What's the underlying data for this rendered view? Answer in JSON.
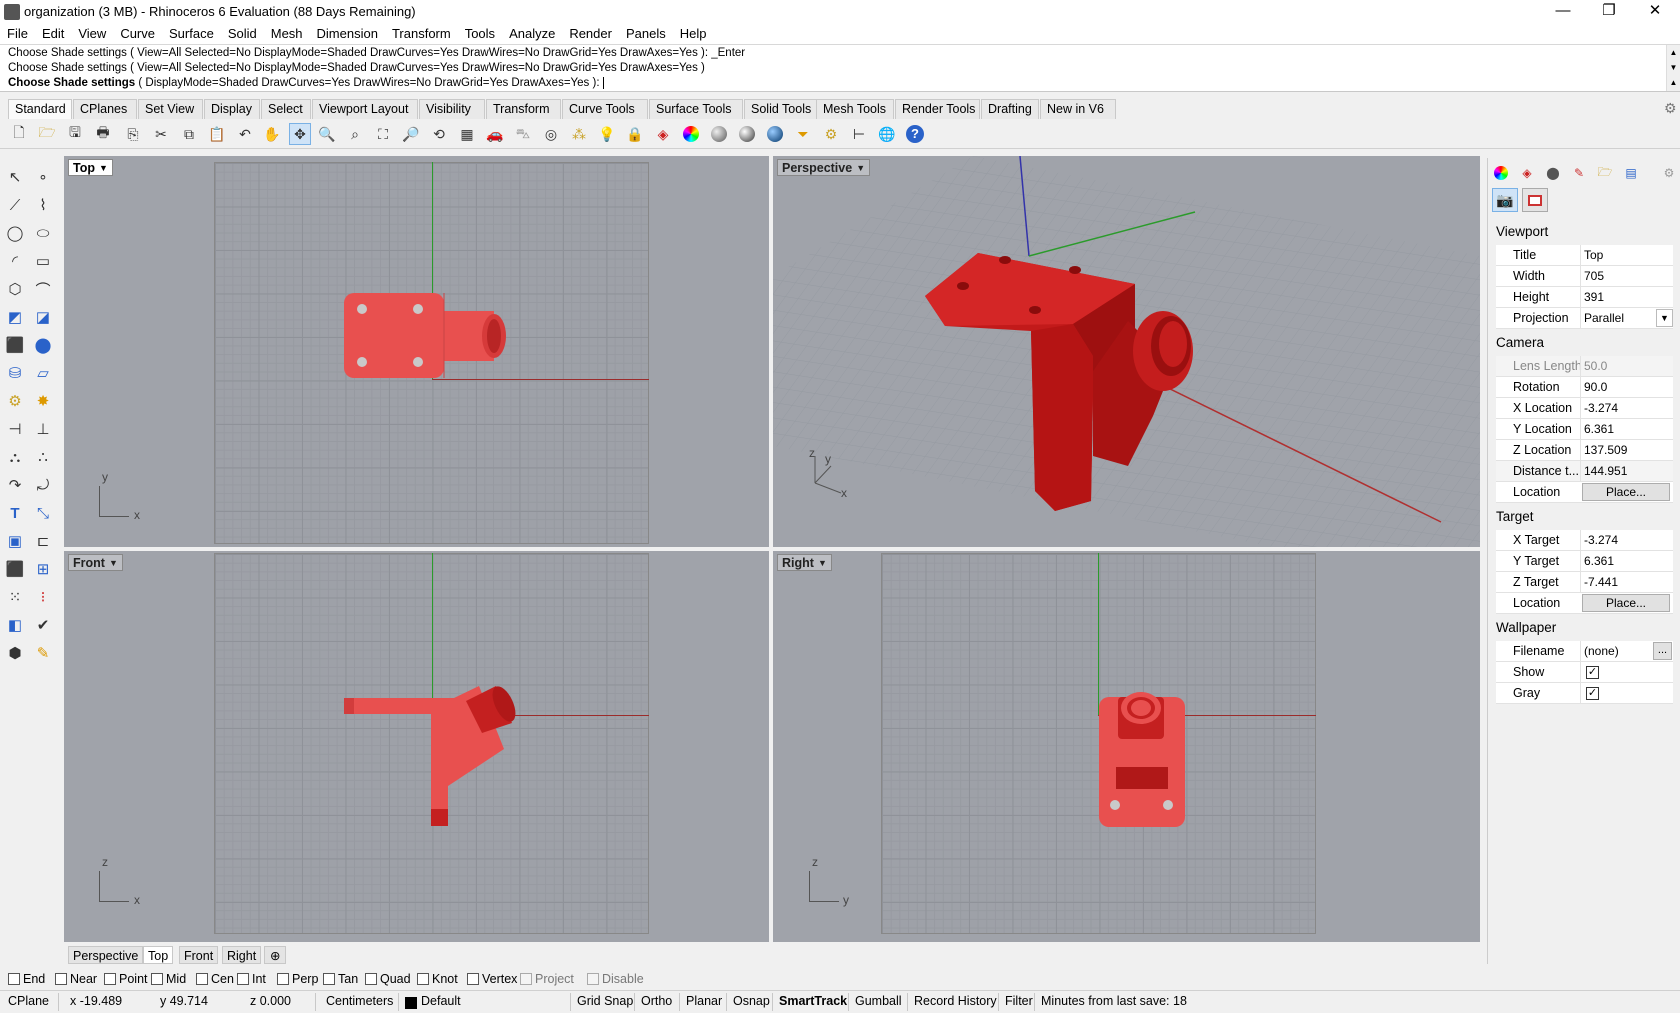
{
  "window": {
    "title": "organization (3 MB) - Rhinoceros 6 Evaluation (88 Days Remaining)",
    "minimize": "—",
    "maximize": "❐",
    "close": "✕"
  },
  "menu": [
    "File",
    "Edit",
    "View",
    "Curve",
    "Surface",
    "Solid",
    "Mesh",
    "Dimension",
    "Transform",
    "Tools",
    "Analyze",
    "Render",
    "Panels",
    "Help"
  ],
  "command": {
    "history": [
      "Choose Shade settings ( View=All  Selected=No  DisplayMode=Shaded  DrawCurves=Yes  DrawWires=No  DrawGrid=Yes  DrawAxes=Yes ): _Enter",
      "Choose Shade settings ( View=All  Selected=No  DisplayMode=Shaded  DrawCurves=Yes  DrawWires=No  DrawGrid=Yes  DrawAxes=Yes )"
    ],
    "prompt_bold": "Choose Shade settings",
    "prompt_rest": " ( DisplayMode=Shaded  DrawCurves=Yes  DrawWires=No  DrawGrid=Yes  DrawAxes=Yes ):"
  },
  "toolbar_tabs": [
    "Standard",
    "CPlanes",
    "Set View",
    "Display",
    "Select",
    "Viewport Layout",
    "Visibility",
    "Transform",
    "Curve Tools",
    "Surface Tools",
    "Solid Tools",
    "Mesh Tools",
    "Render Tools",
    "Drafting",
    "New in V6"
  ],
  "active_toolbar_tab": "Standard",
  "viewports": {
    "top": {
      "label": "Top",
      "ax1": "y",
      "ax2": "x"
    },
    "perspective": {
      "label": "Perspective",
      "ax1": "z",
      "ax2": "y",
      "ax3": "x"
    },
    "front": {
      "label": "Front",
      "ax1": "z",
      "ax2": "x"
    },
    "right": {
      "label": "Right",
      "ax1": "z",
      "ax2": "y"
    }
  },
  "view_tabs": [
    "Perspective",
    "Top",
    "Front",
    "Right"
  ],
  "active_view_tab": "Top",
  "osnaps": [
    {
      "label": "End",
      "checked": false,
      "disabled": false
    },
    {
      "label": "Near",
      "checked": false,
      "disabled": false
    },
    {
      "label": "Point",
      "checked": false,
      "disabled": false
    },
    {
      "label": "Mid",
      "checked": false,
      "disabled": false
    },
    {
      "label": "Cen",
      "checked": false,
      "disabled": false
    },
    {
      "label": "Int",
      "checked": false,
      "disabled": false
    },
    {
      "label": "Perp",
      "checked": false,
      "disabled": false
    },
    {
      "label": "Tan",
      "checked": false,
      "disabled": false
    },
    {
      "label": "Quad",
      "checked": false,
      "disabled": false
    },
    {
      "label": "Knot",
      "checked": false,
      "disabled": false
    },
    {
      "label": "Vertex",
      "checked": false,
      "disabled": false
    },
    {
      "label": "Project",
      "checked": false,
      "disabled": true
    },
    {
      "label": "Disable",
      "checked": false,
      "disabled": true
    }
  ],
  "status": {
    "cplane": "CPlane",
    "x": "x -19.489",
    "y": "y 49.714",
    "z": "z 0.000",
    "units": "Centimeters",
    "layer": "Default",
    "grid_snap": "Grid Snap",
    "ortho": "Ortho",
    "planar": "Planar",
    "osnap": "Osnap",
    "smarttrack": "SmartTrack",
    "gumball": "Gumball",
    "record_history": "Record History",
    "filter": "Filter",
    "last_save": "Minutes from last save: 18"
  },
  "panel": {
    "viewport_header": "Viewport",
    "title_label": "Title",
    "title_value": "Top",
    "width_label": "Width",
    "width_value": "705",
    "height_label": "Height",
    "height_value": "391",
    "projection_label": "Projection",
    "projection_value": "Parallel",
    "camera_header": "Camera",
    "lens_label": "Lens Length",
    "lens_value": "50.0",
    "rotation_label": "Rotation",
    "rotation_value": "90.0",
    "xloc_label": "X Location",
    "xloc_value": "-3.274",
    "yloc_label": "Y Location",
    "yloc_value": "6.361",
    "zloc_label": "Z Location",
    "zloc_value": "137.509",
    "dist_label": "Distance t...",
    "dist_value": "144.951",
    "location_label": "Location",
    "place_button": "Place...",
    "target_header": "Target",
    "xt_label": "X Target",
    "xt_value": "-3.274",
    "yt_label": "Y Target",
    "yt_value": "6.361",
    "zt_label": "Z Target",
    "zt_value": "-7.441",
    "tlocation_label": "Location",
    "tplace_button": "Place...",
    "wallpaper_header": "Wallpaper",
    "filename_label": "Filename",
    "filename_value": "(none)",
    "browse_button": "...",
    "show_label": "Show",
    "show_checked": true,
    "gray_label": "Gray",
    "gray_checked": true
  },
  "colors": {
    "model_red": "#e8504f",
    "model_dark": "#b01818",
    "bg_viewport": "#a0a3aa",
    "axis_green": "#2b9b2b",
    "axis_red": "#9b2b2b"
  }
}
